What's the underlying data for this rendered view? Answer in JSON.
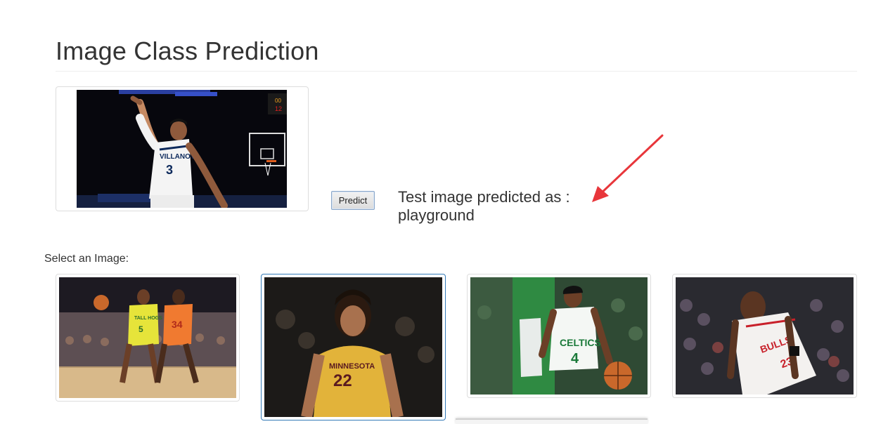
{
  "page": {
    "title": "Image Class Prediction"
  },
  "preview": {
    "jersey_text": "VILLANOVA",
    "jersey_number": "3"
  },
  "predict": {
    "button_label": "Predict",
    "result_prefix": "Test image predicted as :",
    "result_value": "playground"
  },
  "gallery": {
    "label": "Select an Image:",
    "selected_index": 1,
    "items": [
      {
        "jersey_text": "TALL HOGS",
        "jersey_number": "5",
        "second_number": "34"
      },
      {
        "jersey_text": "MINNESOTA",
        "jersey_number": "22"
      },
      {
        "jersey_text": "CELTICS",
        "jersey_number": "4"
      },
      {
        "jersey_text": "BULLS",
        "jersey_number": "23"
      }
    ]
  },
  "colors": {
    "annotation_arrow": "#e8363b",
    "selection_border": "#337ab7"
  }
}
